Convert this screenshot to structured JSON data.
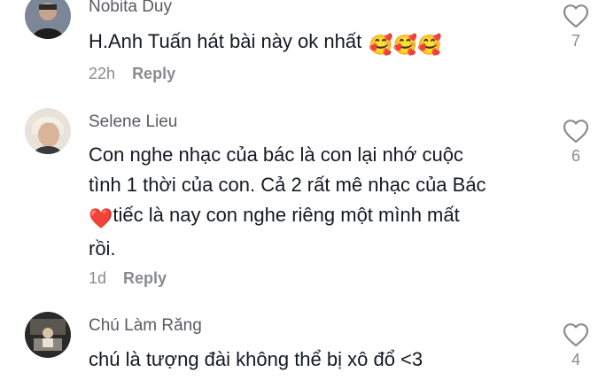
{
  "comments": [
    {
      "username": "Nobita Duy",
      "text": "H.Anh Tuấn hát bài này ok nhất",
      "emoji": "🥰🥰🥰",
      "time": "22h",
      "reply_label": "Reply",
      "likes": "7"
    },
    {
      "username": "Selene Lieu",
      "lines": [
        "Con nghe nhạc của bác là con lại nhớ cuộc",
        "tình 1 thời của con. Cả 2 rất mê nhạc của Bác",
        "tiếc là nay con nghe riêng một mình mất",
        "rồi."
      ],
      "heart_emoji": "❤️",
      "time": "1d",
      "reply_label": "Reply",
      "likes": "6"
    },
    {
      "username": "Chú Làm Răng",
      "text": "chú là tượng đài không thể bị xô đổ <3",
      "likes": "4"
    }
  ],
  "colors": {
    "text": "#161823",
    "username": "#5a5b63",
    "meta": "#8a8b91",
    "heart": "#e53935"
  }
}
